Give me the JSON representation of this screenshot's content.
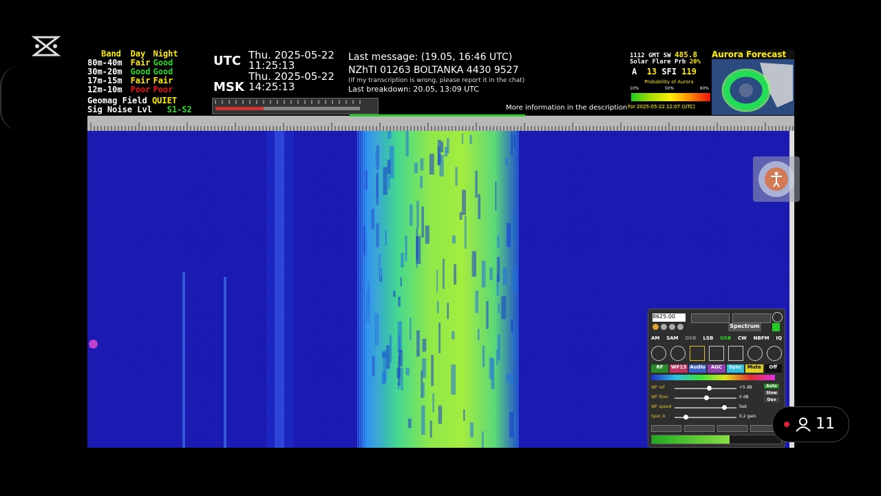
{
  "band_conditions": {
    "headers": [
      "Band",
      "Day",
      "Night"
    ],
    "rows": [
      {
        "band": "80m-40m",
        "day": "Fair",
        "night": "Good"
      },
      {
        "band": "30m-20m",
        "day": "Good",
        "night": "Good"
      },
      {
        "band": "17m-15m",
        "day": "Fair",
        "night": "Fair"
      },
      {
        "band": "12m-10m",
        "day": "Poor",
        "night": "Poor"
      }
    ],
    "geomag_label": "Geomag Field",
    "geomag_value": "QUIET",
    "signal_label": "Sig Noise Lvl",
    "signal_value": "S1-S2"
  },
  "clock": {
    "utc_label": "UTC",
    "utc_date": "Thu. 2025-05-22",
    "utc_time": "11:25:13",
    "msk_label": "MSK",
    "msk_date": "Thu. 2025-05-22",
    "msk_time": "14:25:13"
  },
  "message": {
    "last_message": "Last message: (19.05, 16:46 UTC)",
    "content": "NZhTI 01263 BOLTANKA 4430 9527",
    "note": "(If my transcription is wrong, please report it in the chat)",
    "last_breakdown": "Last breakdown: 20.05, 13:09 UTC",
    "more_info": "More information in the description!"
  },
  "aurora": {
    "title": "Aurora Forecast",
    "line1_prefix": "1112 GMT SW",
    "sw_value": "485.8",
    "flare_label": "Solar Flare Prb",
    "flare_value": "20%",
    "a_label": "A",
    "a_value": "13",
    "sfi_label": "SFI",
    "sfi_value": "119",
    "prob_label": "Probability of Aurora",
    "scale": [
      "10%",
      "50%",
      "90%"
    ],
    "for_label": "For 2025-05-22 12:07 (UTC)"
  },
  "receiver_panel": {
    "frequency": "8625.00",
    "spectrum_label": "Spectrum",
    "modes": [
      "AM",
      "SAM",
      "DSB",
      "LSB",
      "USB",
      "CW",
      "NBFM",
      "IQ"
    ],
    "active_mode": "USB",
    "tabs": [
      "RF",
      "WF13",
      "Audio",
      "AGC",
      "Sync",
      "Mute",
      "Off"
    ],
    "sliders": [
      {
        "label": "WF ref",
        "value": "+5 dB",
        "level": 0.55
      },
      {
        "label": "WF floor",
        "value": "0 dB",
        "level": 0.5
      },
      {
        "label": "WF speed",
        "value": "fast",
        "level": 0.8
      },
      {
        "label": "Spec A",
        "value": "0.2 gain",
        "level": 0.15
      }
    ],
    "side_buttons": [
      "Auto",
      "Slow",
      "Dev"
    ]
  },
  "viewer": {
    "count": "11"
  },
  "colors": {
    "waterfall_bg": "#1a1ab0",
    "signal_green": "#8fe84a",
    "accent_yellow": "#ffee00",
    "good_green": "#22dd22",
    "poor_red": "#ee1111"
  }
}
